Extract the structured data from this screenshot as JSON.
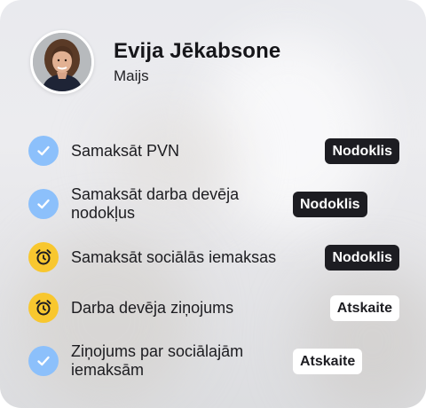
{
  "profile": {
    "name": "Evija Jēkabsone",
    "month": "Maijs"
  },
  "colors": {
    "done": "#8cc0fb",
    "pending": "#f8c72f",
    "tag_dark": "#1d1d22",
    "tag_light": "#ffffff"
  },
  "tasks": [
    {
      "label": "Samaksāt PVN",
      "status": "done",
      "icon": "check-icon",
      "tag": "Nodoklis",
      "tag_style": "dark"
    },
    {
      "label": "Samaksāt darba devēja nodokļus",
      "status": "done",
      "icon": "check-icon",
      "tag": "Nodoklis",
      "tag_style": "dark"
    },
    {
      "label": "Samaksāt sociālās iemaksas",
      "status": "pending",
      "icon": "alarm-clock-icon",
      "tag": "Nodoklis",
      "tag_style": "dark"
    },
    {
      "label": "Darba devēja ziņojums",
      "status": "pending",
      "icon": "alarm-clock-icon",
      "tag": "Atskaite",
      "tag_style": "light"
    },
    {
      "label": "Ziņojums par sociālajām iemaksām",
      "status": "done",
      "icon": "check-icon",
      "tag": "Atskaite",
      "tag_style": "light"
    }
  ]
}
